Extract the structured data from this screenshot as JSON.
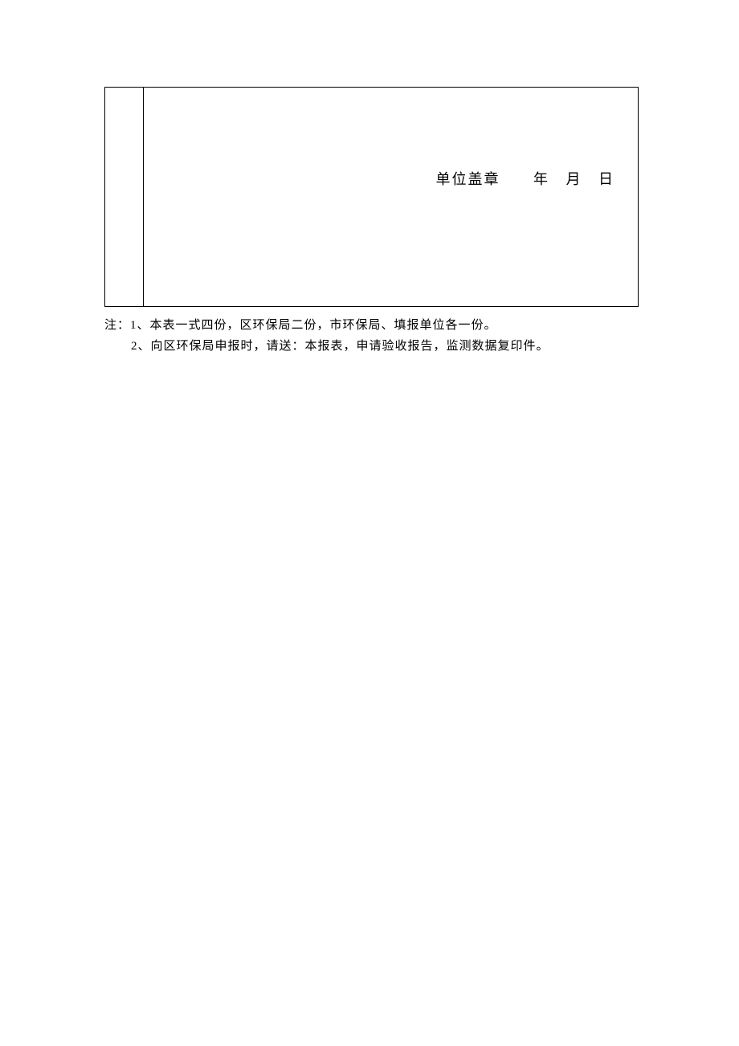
{
  "seal": {
    "label": "单位盖章",
    "year_unit": "年",
    "month_unit": "月",
    "day_unit": "日"
  },
  "notes": {
    "prefix": "注：",
    "line1": "1、本表一式四份，区环保局二份，市环保局、填报单位各一份。",
    "line2": "2、向区环保局申报时，请送：本报表，申请验收报告，监测数据复印件。"
  }
}
